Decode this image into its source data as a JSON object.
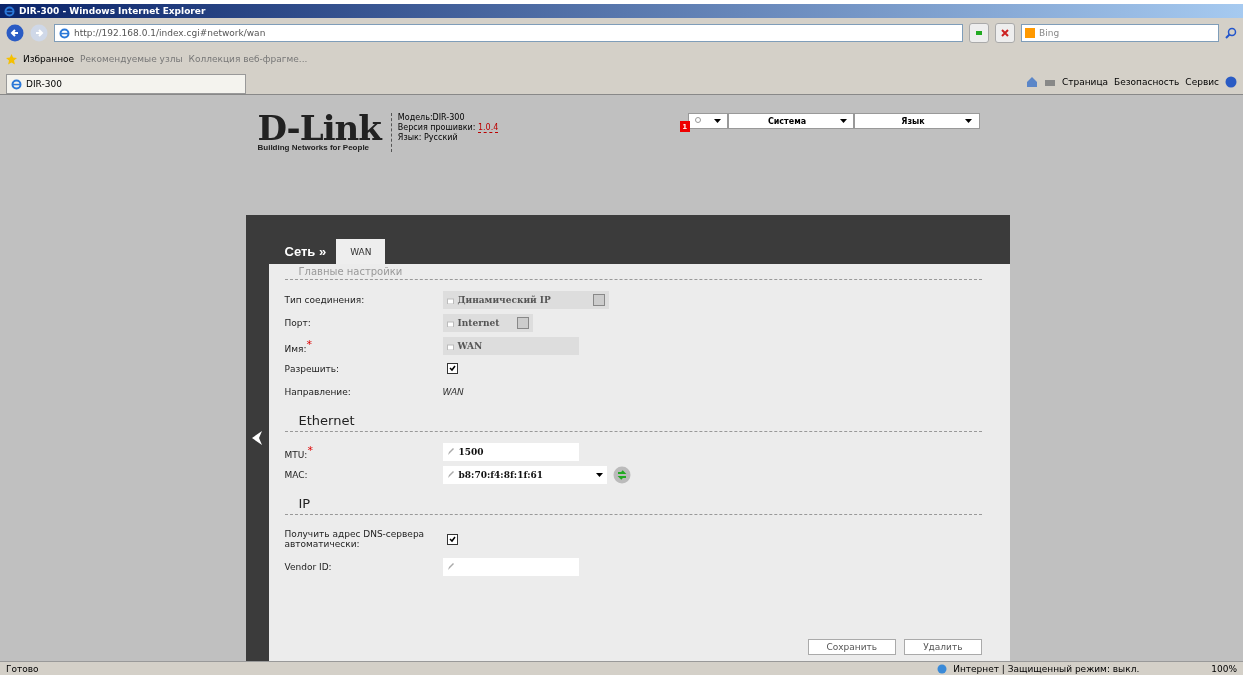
{
  "window": {
    "title": "DIR-300 - Windows Internet Explorer"
  },
  "address": {
    "url": "http://192.168.0.1/index.cgi#network/wan"
  },
  "search": {
    "placeholder": "Bing"
  },
  "favorites": {
    "label": "Избранное",
    "links": [
      "Рекомендуемые узлы",
      "Коллекция веб-фрагме..."
    ]
  },
  "browser_tabs": [
    {
      "label": "DIR-300",
      "selected": true
    }
  ],
  "command_bar": [
    "Страница",
    "Безопасность",
    "Сервис"
  ],
  "header": {
    "logo": "D-Link",
    "tagline": "Building Networks for People",
    "model": "Модель:DIR-300",
    "firmware_label": "Версия прошивки:",
    "firmware_version": "1.0.4",
    "language": "Язык: Русский",
    "notifications": "1",
    "menus": [
      "Система",
      "Язык"
    ]
  },
  "breadcrumb": "Сеть »",
  "page_tabs": [
    {
      "label": "WAN",
      "selected": true
    }
  ],
  "sections": [
    {
      "title": "Главные настройки",
      "rows": [
        {
          "kind": "select",
          "label": "Тип соединения:",
          "value": "Динамический IP",
          "disabled": true
        },
        {
          "kind": "select",
          "label": "Порт:",
          "value": "Internet",
          "disabled": true
        },
        {
          "kind": "input",
          "label": "Имя:$^{*}$",
          "value": "WAN",
          "disabled": true
        },
        {
          "kind": "checkbox",
          "label": "Разрешить:",
          "checked": true
        },
        {
          "kind": "text",
          "label": "Направление:",
          "value": "WAN"
        }
      ]
    },
    {
      "title": "Ethernet",
      "rows": [
        {
          "kind": "input",
          "label": "MTU:$^{*}$",
          "value": "1500",
          "disabled": false
        },
        {
          "kind": "combo",
          "label": "MAC:",
          "value": "b8:70:f4:8f:1f:61"
        }
      ]
    },
    {
      "title": "IP",
      "rows": [
        {
          "kind": "checkbox",
          "label": "Получить адрес DNS-сервера автоматически:",
          "checked": true
        },
        {
          "kind": "input",
          "label": "Vendor ID:",
          "disabled": false
        }
      ]
    }
  ],
  "buttons": [
    "Сохранить",
    "Удалить"
  ],
  "status_bar": {
    "text": "Готово",
    "zone": "Интернет | Защищенный режим: выкл.",
    "zoom": "100%"
  }
}
